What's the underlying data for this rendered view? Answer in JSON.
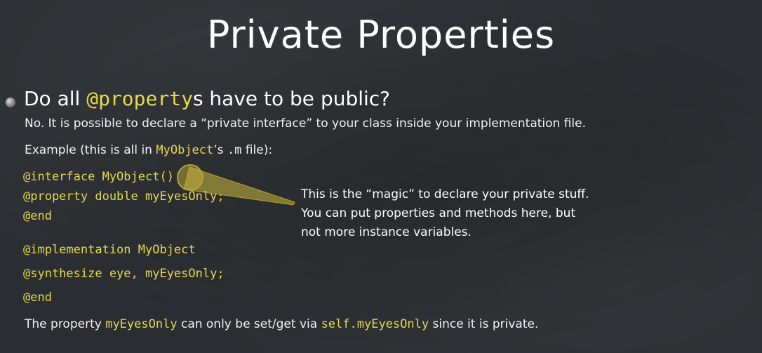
{
  "title": "Private Properties",
  "bullet": {
    "pre": "Do all ",
    "code": "@property",
    "post": "s have to be public?"
  },
  "answer": "No.  It is possible to declare a “private interface” to your class inside your implementation file.",
  "example": {
    "pre": "Example (this is all in ",
    "code1": "MyObject",
    "mid": "’s ",
    "code2": ".m",
    "post": " file):"
  },
  "code_lines": {
    "interface": "@interface MyObject",
    "parens": "()",
    "property": "@property double myEyesOnly;",
    "end1": "@end",
    "implementation": "@implementation MyObject",
    "synthesize": "@synthesize eye, myEyesOnly;",
    "end2": "@end"
  },
  "callout": [
    "This is the “magic” to declare your private stuff.",
    "You can put properties and methods here, but",
    "not more instance variables."
  ],
  "footer": {
    "pre": "The property ",
    "code1": "myEyesOnly",
    "mid": " can only be set/get via ",
    "code2": "self.myEyesOnly",
    "post": " since it is private."
  },
  "colors": {
    "background": "#2a2d31",
    "highlight": "#e6d94a",
    "text": "#f2f2f2",
    "pointer": "#b5a52b"
  }
}
